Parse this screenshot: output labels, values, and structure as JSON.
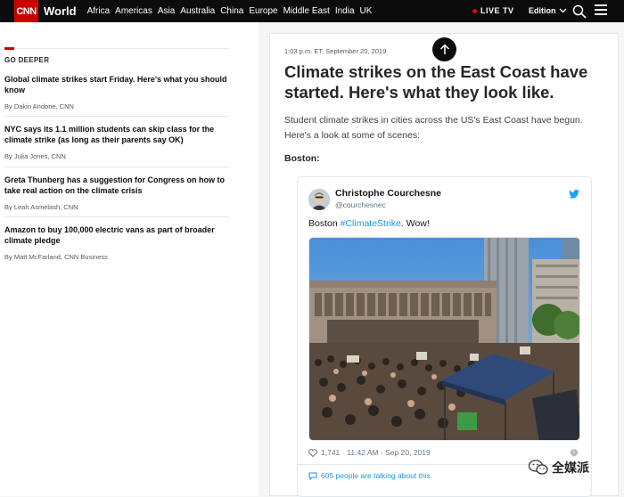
{
  "header": {
    "logo": "CNN",
    "section": "World",
    "nav": [
      "Africa",
      "Americas",
      "Asia",
      "Australia",
      "China",
      "Europe",
      "Middle East",
      "India",
      "UK"
    ],
    "live_tv": "LIVE TV",
    "edition": "Edition"
  },
  "sidebar": {
    "title": "GO DEEPER",
    "stories": [
      {
        "headline": "Global climate strikes start Friday. Here's what you should know",
        "byline": "By Dakin Andone, CNN"
      },
      {
        "headline": "NYC says its 1.1 million students can skip class for the climate strike (as long as their parents say OK)",
        "byline": "By Julia Jones, CNN"
      },
      {
        "headline": "Greta Thunberg has a suggestion for Congress on how to take real action on the climate crisis",
        "byline": "By Leah Asmelash, CNN"
      },
      {
        "headline": "Amazon to buy 100,000 electric vans as part of broader climate pledge",
        "byline": "By Matt McFarland, CNN Business"
      }
    ]
  },
  "article": {
    "timestamp": "1:03 p.m. ET, September 20, 2019",
    "headline": "Climate strikes on the East Coast have started. Here's what they look like.",
    "intro": "Student climate strikes in cities across the US's East Coast have begun. Here's a look at some of scenes:",
    "city": "Boston:"
  },
  "tweet": {
    "name": "Christophe Courchesne",
    "handle": "@courchesnec",
    "text_prefix": "Boston ",
    "hashtag": "#ClimateStrike",
    "text_suffix": ". Wow!",
    "likes": "1,741",
    "time": "11:42 AM - Sep 20, 2019",
    "talking": "605 people are talking about this",
    "link_color": "#1b95e0"
  },
  "watermark": {
    "text": "全媒派"
  },
  "colors": {
    "brand": "#cc0000",
    "topbar": "#0c0c0c"
  }
}
